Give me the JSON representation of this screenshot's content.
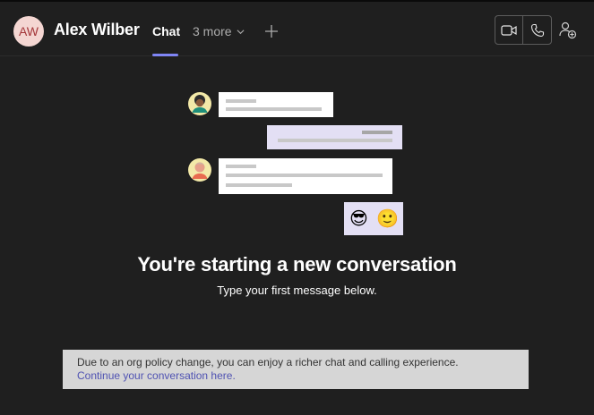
{
  "header": {
    "avatar_initials": "AW",
    "contact_name": "Alex Wilber",
    "tabs": [
      {
        "label": "Chat",
        "active": true
      },
      {
        "label": "3 more",
        "dropdown": true
      }
    ],
    "icons": {
      "add_tab": "plus-icon",
      "video_call": "video-camera-icon",
      "audio_call": "phone-icon",
      "add_people": "add-people-icon",
      "more_dropdown": "chevron-down-icon"
    }
  },
  "empty_state": {
    "title": "You're starting a new conversation",
    "subtitle": "Type your first message below.",
    "emoji": [
      "😎",
      "🙂"
    ]
  },
  "banner": {
    "text": "Due to an org policy change, you can enjoy a richer chat and calling experience.",
    "link_text": "Continue your conversation here."
  },
  "colors": {
    "background": "#1f1f1f",
    "accent": "#7f85f5",
    "avatar_bg": "#f4d6d2",
    "avatar_text": "#a4373a",
    "banner_bg": "#d6d6d6",
    "link": "#4f52b2"
  }
}
